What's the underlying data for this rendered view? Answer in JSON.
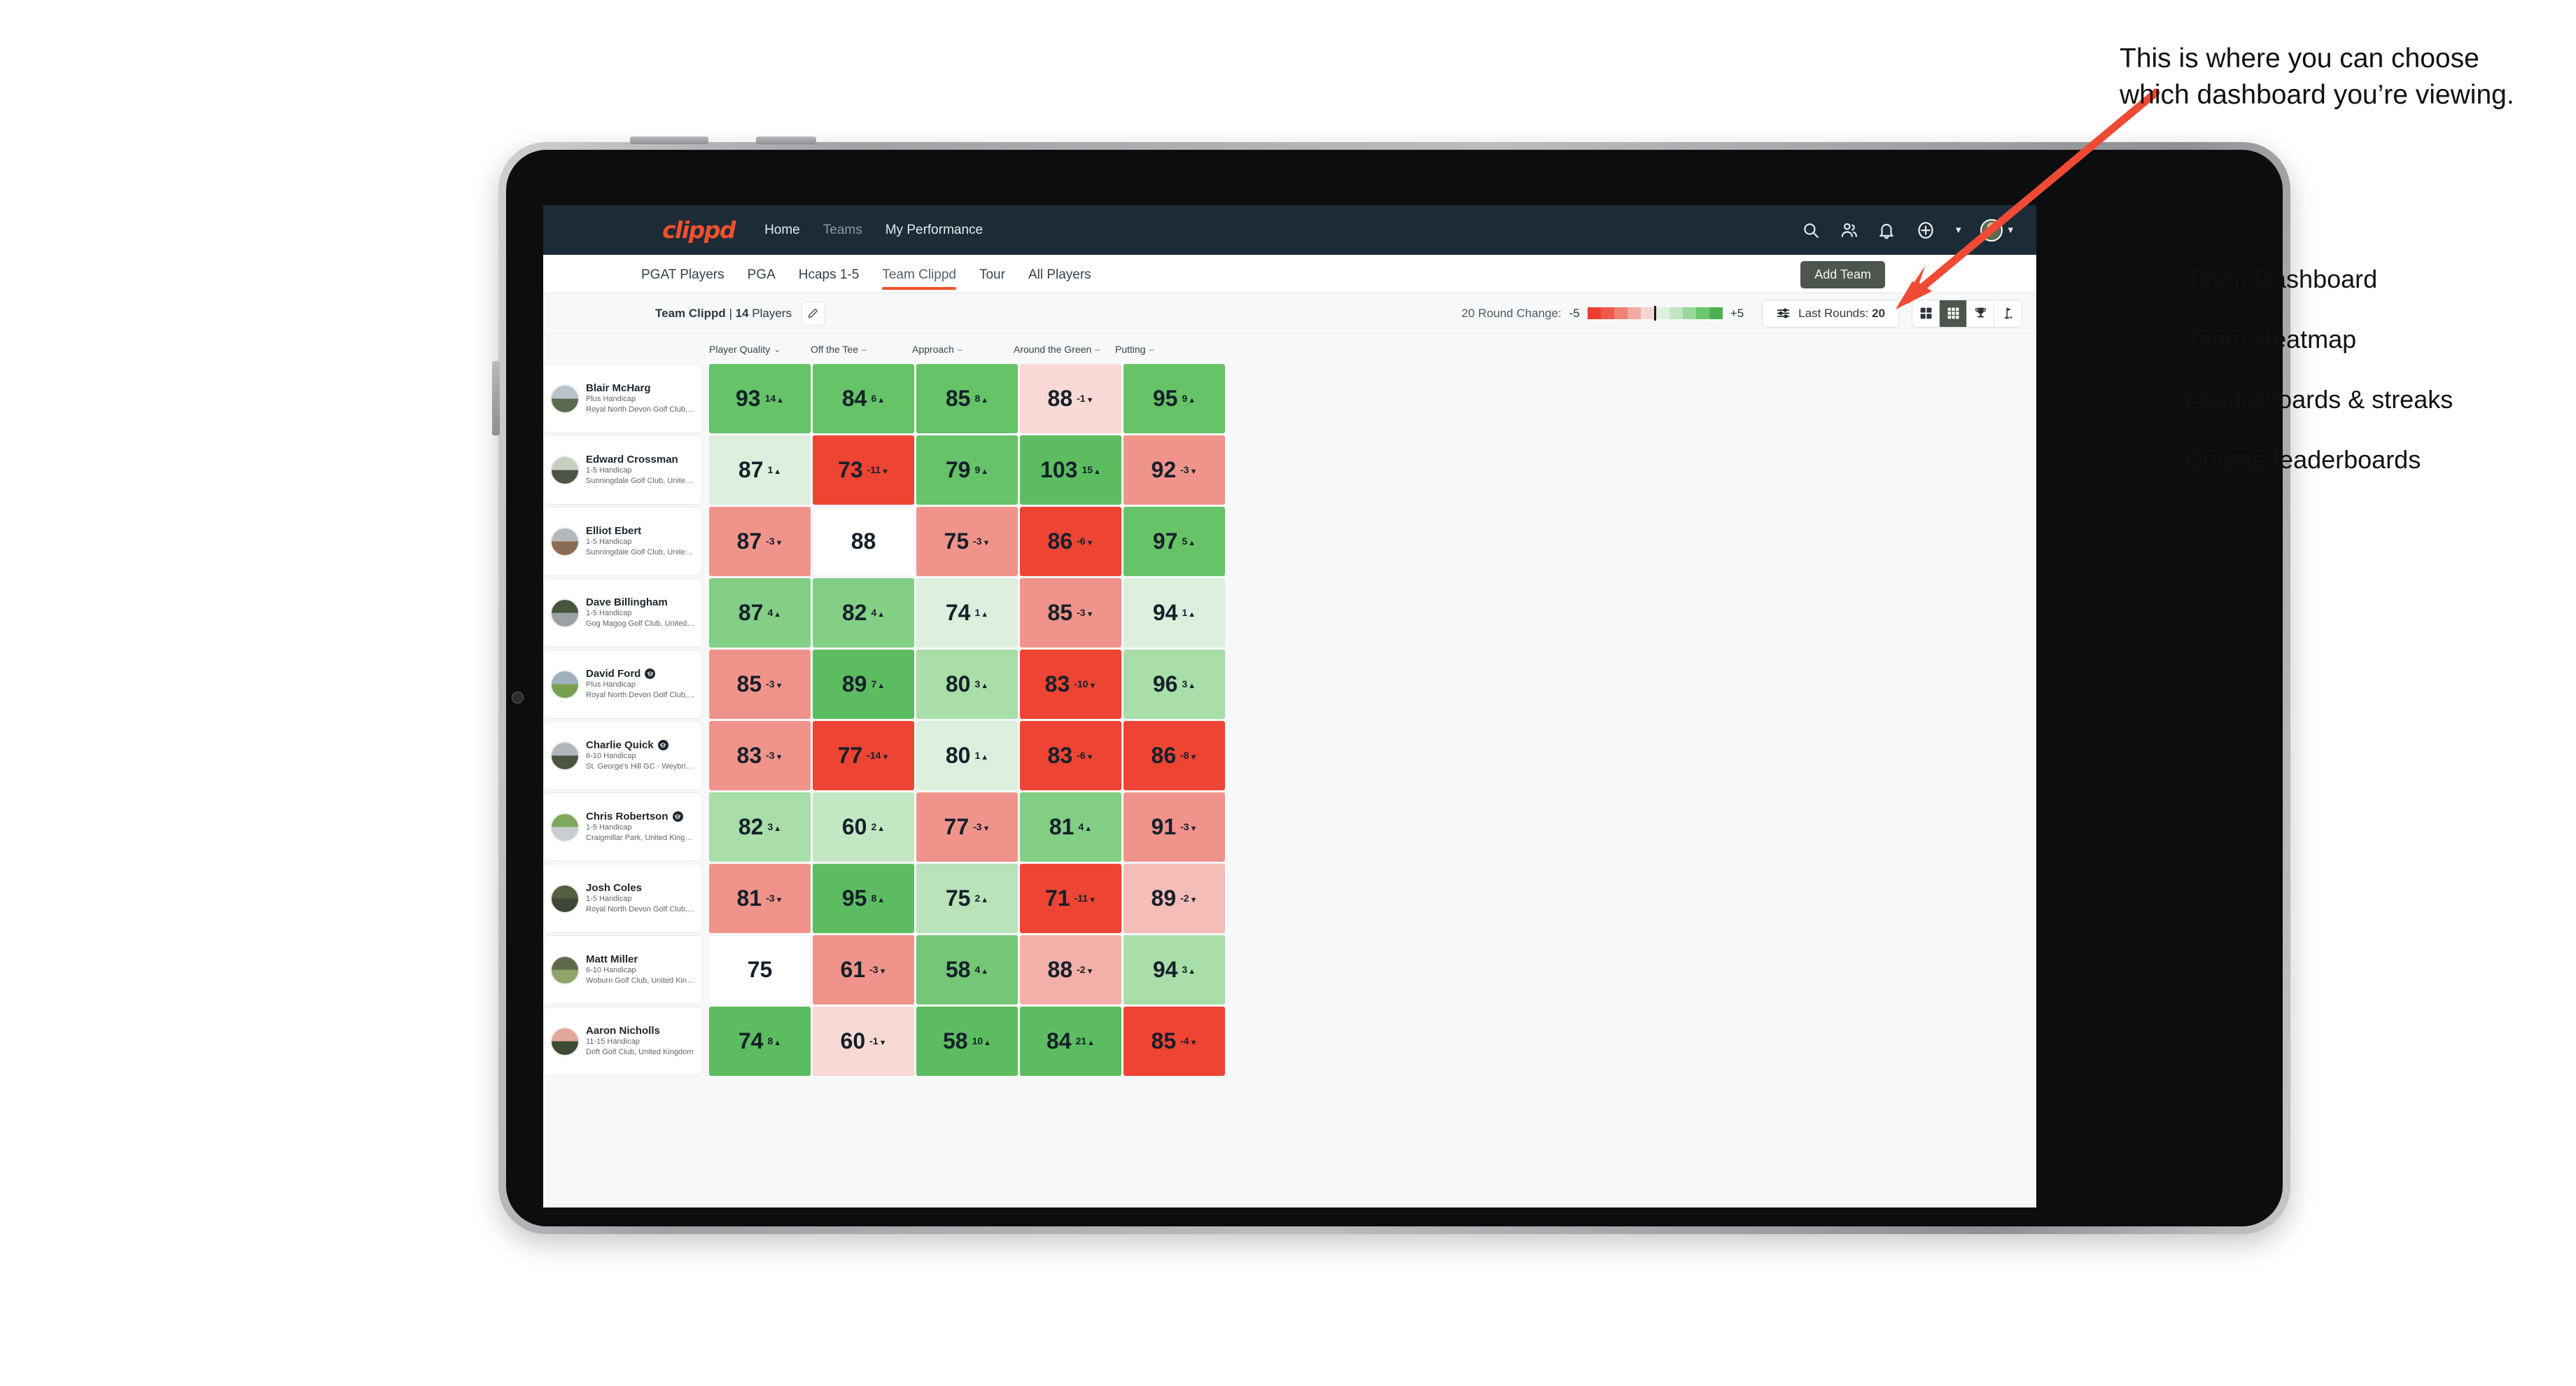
{
  "brand": "clippd",
  "nav": {
    "links": [
      {
        "label": "Home",
        "active": true
      },
      {
        "label": "Teams",
        "active": false
      },
      {
        "label": "My Performance",
        "active": true
      }
    ],
    "icons": [
      "search-icon",
      "people-icon",
      "bell-icon",
      "plus-circle-icon",
      "avatar"
    ]
  },
  "subnav": {
    "tabs": [
      {
        "label": "PGAT Players"
      },
      {
        "label": "PGA"
      },
      {
        "label": "Hcaps 1-5"
      },
      {
        "label": "Team Clippd"
      },
      {
        "label": "Tour"
      },
      {
        "label": "All Players"
      }
    ],
    "active_index": 3,
    "add_team_label": "Add Team"
  },
  "toolbar": {
    "team_name": "Team Clippd",
    "team_sep": " | ",
    "player_count": "14",
    "players_word": " Players",
    "legend_label": "20 Round Change:",
    "legend_min": "-5",
    "legend_max": "+5",
    "rounds_label": "Last Rounds:",
    "rounds_value": "20",
    "views": [
      {
        "name": "team-dashboard",
        "icon": "grid-2x2-icon",
        "active": false
      },
      {
        "name": "team-heatmap",
        "icon": "grid-3x3-icon",
        "active": true
      },
      {
        "name": "leaderboards-streaks",
        "icon": "trophy-icon",
        "active": false
      },
      {
        "name": "course-leaderboards",
        "icon": "golf-flag-icon",
        "active": false
      }
    ]
  },
  "columns": [
    {
      "label": "Player Quality",
      "mark": "chevron-down-icon",
      "glyph": "⌄"
    },
    {
      "label": "Off the Tee",
      "mark": "dash-icon",
      "glyph": "–"
    },
    {
      "label": "Approach",
      "mark": "dash-icon",
      "glyph": "–"
    },
    {
      "label": "Around the Green",
      "mark": "dash-icon",
      "glyph": "–"
    },
    {
      "label": "Putting",
      "mark": "dash-icon",
      "glyph": "–"
    }
  ],
  "legend_swatches": [
    "#ef3e2e",
    "#ef5a4a",
    "#ef8277",
    "#f2aaa3",
    "#f8d5d1",
    "#1b1b1b",
    "#e0f0e0",
    "#c3e5c2",
    "#9ad79a",
    "#6cc56d",
    "#4cb050"
  ],
  "players": [
    {
      "name": "Blair McHarg",
      "grad": false,
      "handicap": "Plus Handicap",
      "club": "Royal North Devon Golf Club, United Kingdom",
      "avatar_top": "#b9c3cc",
      "avatar_bottom": "#5a6b4e",
      "cells": [
        {
          "value": "93",
          "delta": "14",
          "dir": "up",
          "bg": "#66c368"
        },
        {
          "value": "84",
          "delta": "6",
          "dir": "up",
          "bg": "#66c368"
        },
        {
          "value": "85",
          "delta": "8",
          "dir": "up",
          "bg": "#66c368"
        },
        {
          "value": "88",
          "delta": "-1",
          "dir": "down",
          "bg": "#f8d9d5"
        },
        {
          "value": "95",
          "delta": "9",
          "dir": "up",
          "bg": "#66c368"
        }
      ]
    },
    {
      "name": "Edward Crossman",
      "grad": false,
      "handicap": "1-5 Handicap",
      "club": "Sunningdale Golf Club, United Kingdom",
      "avatar_top": "#c8cfc0",
      "avatar_bottom": "#4d5446",
      "cells": [
        {
          "value": "87",
          "delta": "1",
          "dir": "up",
          "bg": "#ddeedd"
        },
        {
          "value": "73",
          "delta": "-11",
          "dir": "down",
          "bg": "#ee4433"
        },
        {
          "value": "79",
          "delta": "9",
          "dir": "up",
          "bg": "#66c368"
        },
        {
          "value": "103",
          "delta": "15",
          "dir": "up",
          "bg": "#5cbd60"
        },
        {
          "value": "92",
          "delta": "-3",
          "dir": "down",
          "bg": "#f0948b"
        }
      ]
    },
    {
      "name": "Elliot Ebert",
      "grad": false,
      "handicap": "1-5 Handicap",
      "club": "Sunningdale Golf Club, United Kingdom",
      "avatar_top": "#b4b8ba",
      "avatar_bottom": "#8a6a52",
      "cells": [
        {
          "value": "87",
          "delta": "-3",
          "dir": "down",
          "bg": "#f0948b"
        },
        {
          "value": "88",
          "delta": "",
          "dir": "",
          "bg": "#ffffff"
        },
        {
          "value": "75",
          "delta": "-3",
          "dir": "down",
          "bg": "#f0948b"
        },
        {
          "value": "86",
          "delta": "-6",
          "dir": "down",
          "bg": "#ee4433"
        },
        {
          "value": "97",
          "delta": "5",
          "dir": "up",
          "bg": "#66c368"
        }
      ]
    },
    {
      "name": "Dave Billingham",
      "grad": false,
      "handicap": "1-5 Handicap",
      "club": "Gog Magog Golf Club, United Kingdom",
      "avatar_top": "#46543c",
      "avatar_bottom": "#9aa0a3",
      "cells": [
        {
          "value": "87",
          "delta": "4",
          "dir": "up",
          "bg": "#83cf85"
        },
        {
          "value": "82",
          "delta": "4",
          "dir": "up",
          "bg": "#83cf85"
        },
        {
          "value": "74",
          "delta": "1",
          "dir": "up",
          "bg": "#ddeedd"
        },
        {
          "value": "85",
          "delta": "-3",
          "dir": "down",
          "bg": "#f0948b"
        },
        {
          "value": "94",
          "delta": "1",
          "dir": "up",
          "bg": "#ddeedd"
        }
      ]
    },
    {
      "name": "David Ford",
      "grad": true,
      "handicap": "Plus Handicap",
      "club": "Royal North Devon Golf Club, United Kingdom",
      "avatar_top": "#9fb0bd",
      "avatar_bottom": "#79a04e",
      "cells": [
        {
          "value": "85",
          "delta": "-3",
          "dir": "down",
          "bg": "#f0948b"
        },
        {
          "value": "89",
          "delta": "7",
          "dir": "up",
          "bg": "#5cbd60"
        },
        {
          "value": "80",
          "delta": "3",
          "dir": "up",
          "bg": "#a8dea8"
        },
        {
          "value": "83",
          "delta": "-10",
          "dir": "down",
          "bg": "#ee4433"
        },
        {
          "value": "96",
          "delta": "3",
          "dir": "up",
          "bg": "#a8dea8"
        }
      ]
    },
    {
      "name": "Charlie Quick",
      "grad": true,
      "handicap": "6-10 Handicap",
      "club": "St. George's Hill GC - Weybridge - Surrey, Uni...",
      "avatar_top": "#b0b6bb",
      "avatar_bottom": "#4b5640",
      "cells": [
        {
          "value": "83",
          "delta": "-3",
          "dir": "down",
          "bg": "#f0948b"
        },
        {
          "value": "77",
          "delta": "-14",
          "dir": "down",
          "bg": "#ee4433"
        },
        {
          "value": "80",
          "delta": "1",
          "dir": "up",
          "bg": "#ddeedd"
        },
        {
          "value": "83",
          "delta": "-6",
          "dir": "down",
          "bg": "#ee4433"
        },
        {
          "value": "86",
          "delta": "-8",
          "dir": "down",
          "bg": "#ee4433"
        }
      ]
    },
    {
      "name": "Chris Robertson",
      "grad": true,
      "handicap": "1-5 Handicap",
      "club": "Craigmillar Park, United Kingdom",
      "avatar_top": "#7fa85f",
      "avatar_bottom": "#c8cdd1",
      "cells": [
        {
          "value": "82",
          "delta": "3",
          "dir": "up",
          "bg": "#a8dea8"
        },
        {
          "value": "60",
          "delta": "2",
          "dir": "up",
          "bg": "#c3e7c3"
        },
        {
          "value": "77",
          "delta": "-3",
          "dir": "down",
          "bg": "#f0948b"
        },
        {
          "value": "81",
          "delta": "4",
          "dir": "up",
          "bg": "#83cf85"
        },
        {
          "value": "91",
          "delta": "-3",
          "dir": "down",
          "bg": "#f0948b"
        }
      ]
    },
    {
      "name": "Josh Coles",
      "grad": false,
      "handicap": "1-5 Handicap",
      "club": "Royal North Devon Golf Club, United Kingdom",
      "avatar_top": "#53603f",
      "avatar_bottom": "#3d4733",
      "cells": [
        {
          "value": "81",
          "delta": "-3",
          "dir": "down",
          "bg": "#f0948b"
        },
        {
          "value": "95",
          "delta": "8",
          "dir": "up",
          "bg": "#5cbd60"
        },
        {
          "value": "75",
          "delta": "2",
          "dir": "up",
          "bg": "#b9e3b9"
        },
        {
          "value": "71",
          "delta": "-11",
          "dir": "down",
          "bg": "#ee4433"
        },
        {
          "value": "89",
          "delta": "-2",
          "dir": "down",
          "bg": "#f5bdb7"
        }
      ]
    },
    {
      "name": "Matt Miller",
      "grad": false,
      "handicap": "6-10 Handicap",
      "club": "Woburn Golf Club, United Kingdom",
      "avatar_top": "#5d6b4c",
      "avatar_bottom": "#8fa468",
      "cells": [
        {
          "value": "75",
          "delta": "",
          "dir": "",
          "bg": "#ffffff"
        },
        {
          "value": "61",
          "delta": "-3",
          "dir": "down",
          "bg": "#f0948b"
        },
        {
          "value": "58",
          "delta": "4",
          "dir": "up",
          "bg": "#74c776"
        },
        {
          "value": "88",
          "delta": "-2",
          "dir": "down",
          "bg": "#f3b0a9"
        },
        {
          "value": "94",
          "delta": "3",
          "dir": "up",
          "bg": "#a8dea8"
        }
      ]
    },
    {
      "name": "Aaron Nicholls",
      "grad": false,
      "handicap": "11-15 Handicap",
      "club": "Drift Golf Club, United Kingdom",
      "avatar_top": "#e3a79a",
      "avatar_bottom": "#3e4a33",
      "cells": [
        {
          "value": "74",
          "delta": "8",
          "dir": "up",
          "bg": "#5cbd60"
        },
        {
          "value": "60",
          "delta": "-1",
          "dir": "down",
          "bg": "#f8d9d5"
        },
        {
          "value": "58",
          "delta": "10",
          "dir": "up",
          "bg": "#5cbd60"
        },
        {
          "value": "84",
          "delta": "21",
          "dir": "up",
          "bg": "#5cbd60"
        },
        {
          "value": "85",
          "delta": "-4",
          "dir": "down",
          "bg": "#ee4433"
        }
      ]
    }
  ],
  "annotation": {
    "paragraph": "This is where you can choose which dashboard you’re viewing.",
    "items": [
      "Team Dashboard",
      "Team Heatmap",
      "Leaderboards & streaks",
      "Course leaderboards"
    ],
    "arrow_color": "#ef4a35"
  }
}
